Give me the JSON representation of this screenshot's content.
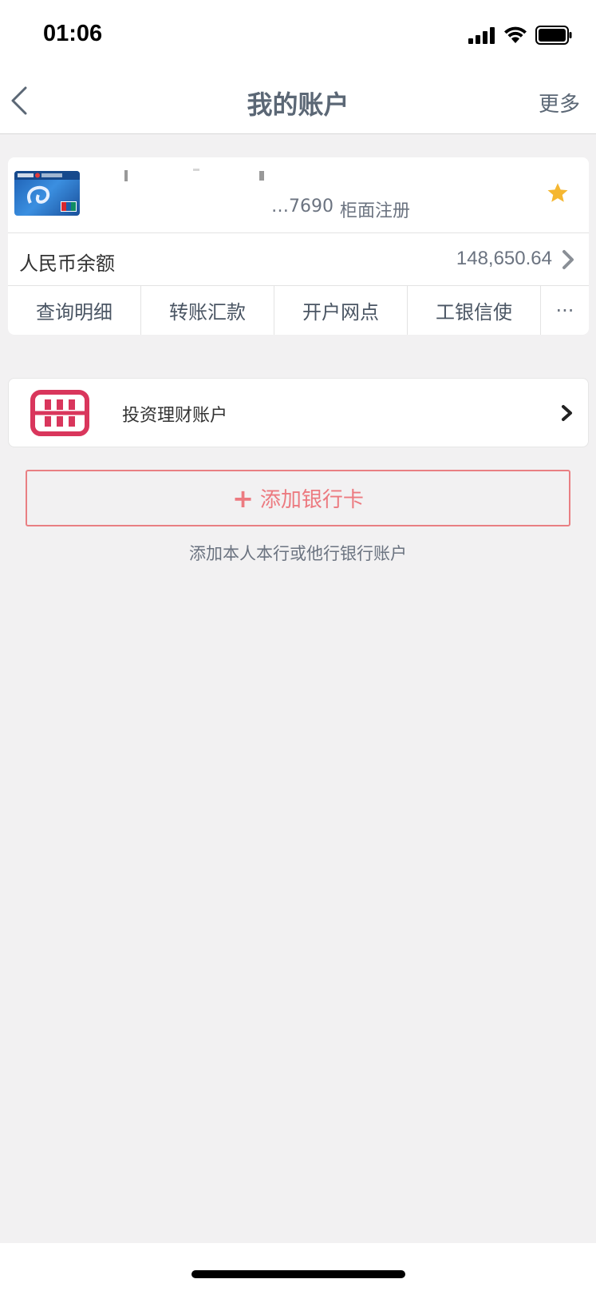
{
  "status": {
    "time": "01:06"
  },
  "nav": {
    "title": "我的账户",
    "more": "更多"
  },
  "account": {
    "number_suffix": "…7690",
    "registration": "柜面注册",
    "balance_label": "人民币余额",
    "balance_value": "148,650.64"
  },
  "actions": [
    {
      "label": "查询明细"
    },
    {
      "label": "转账汇款"
    },
    {
      "label": "开户网点"
    },
    {
      "label": "工银信使"
    },
    {
      "label": "···"
    }
  ],
  "invest": {
    "label": "投资理财账户"
  },
  "add_card": {
    "plus": "+",
    "label": "添加银行卡",
    "hint": "添加本人本行或他行银行账户"
  },
  "colors": {
    "accent": "#ec7a80",
    "star": "#f5b731",
    "invest_icon": "#d9365c"
  }
}
